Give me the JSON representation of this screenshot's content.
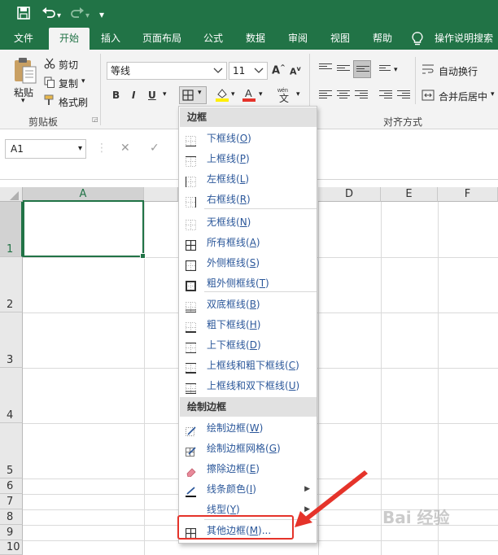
{
  "quick_access": {
    "save_icon": "save-icon",
    "undo_icon": "undo-icon",
    "redo_icon": "redo-icon",
    "customize_icon": "customize-icon"
  },
  "tabs": [
    {
      "label": "文件"
    },
    {
      "label": "开始"
    },
    {
      "label": "插入"
    },
    {
      "label": "页面布局"
    },
    {
      "label": "公式"
    },
    {
      "label": "数据"
    },
    {
      "label": "审阅"
    },
    {
      "label": "视图"
    },
    {
      "label": "帮助"
    },
    {
      "label": "操作说明搜索"
    }
  ],
  "clipboard": {
    "paste": "粘贴",
    "cut": "剪切",
    "copy": "复制",
    "format_painter": "格式刷",
    "group_label": "剪贴板"
  },
  "font": {
    "name": "等线",
    "size": "11",
    "bold": "B",
    "italic": "I",
    "underline": "U"
  },
  "alignment": {
    "wrap_text": "自动换行",
    "merge_center": "合并后居中",
    "group_label": "对齐方式"
  },
  "formula_bar": {
    "name_box": "A1",
    "cancel": "✕",
    "enter": "✓"
  },
  "columns": [
    "A",
    "D",
    "E",
    "F"
  ],
  "rows": [
    "1",
    "2",
    "3",
    "4",
    "5",
    "6",
    "7",
    "8",
    "9",
    "10"
  ],
  "menu": {
    "header1": "边框",
    "header2": "绘制边框",
    "items1": [
      {
        "label": "下框线(",
        "key": "O",
        "end": ")"
      },
      {
        "label": "上框线(",
        "key": "P",
        "end": ")"
      },
      {
        "label": "左框线(",
        "key": "L",
        "end": ")"
      },
      {
        "label": "右框线(",
        "key": "R",
        "end": ")"
      },
      {
        "label": "无框线(",
        "key": "N",
        "end": ")"
      },
      {
        "label": "所有框线(",
        "key": "A",
        "end": ")"
      },
      {
        "label": "外侧框线(",
        "key": "S",
        "end": ")"
      },
      {
        "label": "粗外侧框线(",
        "key": "T",
        "end": ")"
      },
      {
        "label": "双底框线(",
        "key": "B",
        "end": ")"
      },
      {
        "label": "粗下框线(",
        "key": "H",
        "end": ")"
      },
      {
        "label": "上下框线(",
        "key": "D",
        "end": ")"
      },
      {
        "label": "上框线和粗下框线(",
        "key": "C",
        "end": ")"
      },
      {
        "label": "上框线和双下框线(",
        "key": "U",
        "end": ")"
      }
    ],
    "items2": [
      {
        "label": "绘制边框(",
        "key": "W",
        "end": ")"
      },
      {
        "label": "绘制边框网格(",
        "key": "G",
        "end": ")"
      },
      {
        "label": "擦除边框(",
        "key": "E",
        "end": ")"
      },
      {
        "label": "线条颜色(",
        "key": "I",
        "end": ")"
      },
      {
        "label": "线型(",
        "key": "Y",
        "end": ")"
      },
      {
        "label": "其他边框(",
        "key": "M",
        "end": ")..."
      }
    ]
  },
  "watermark": "Bai 经验",
  "colors": {
    "excel_green": "#217346",
    "highlight_red": "#e5332a"
  }
}
